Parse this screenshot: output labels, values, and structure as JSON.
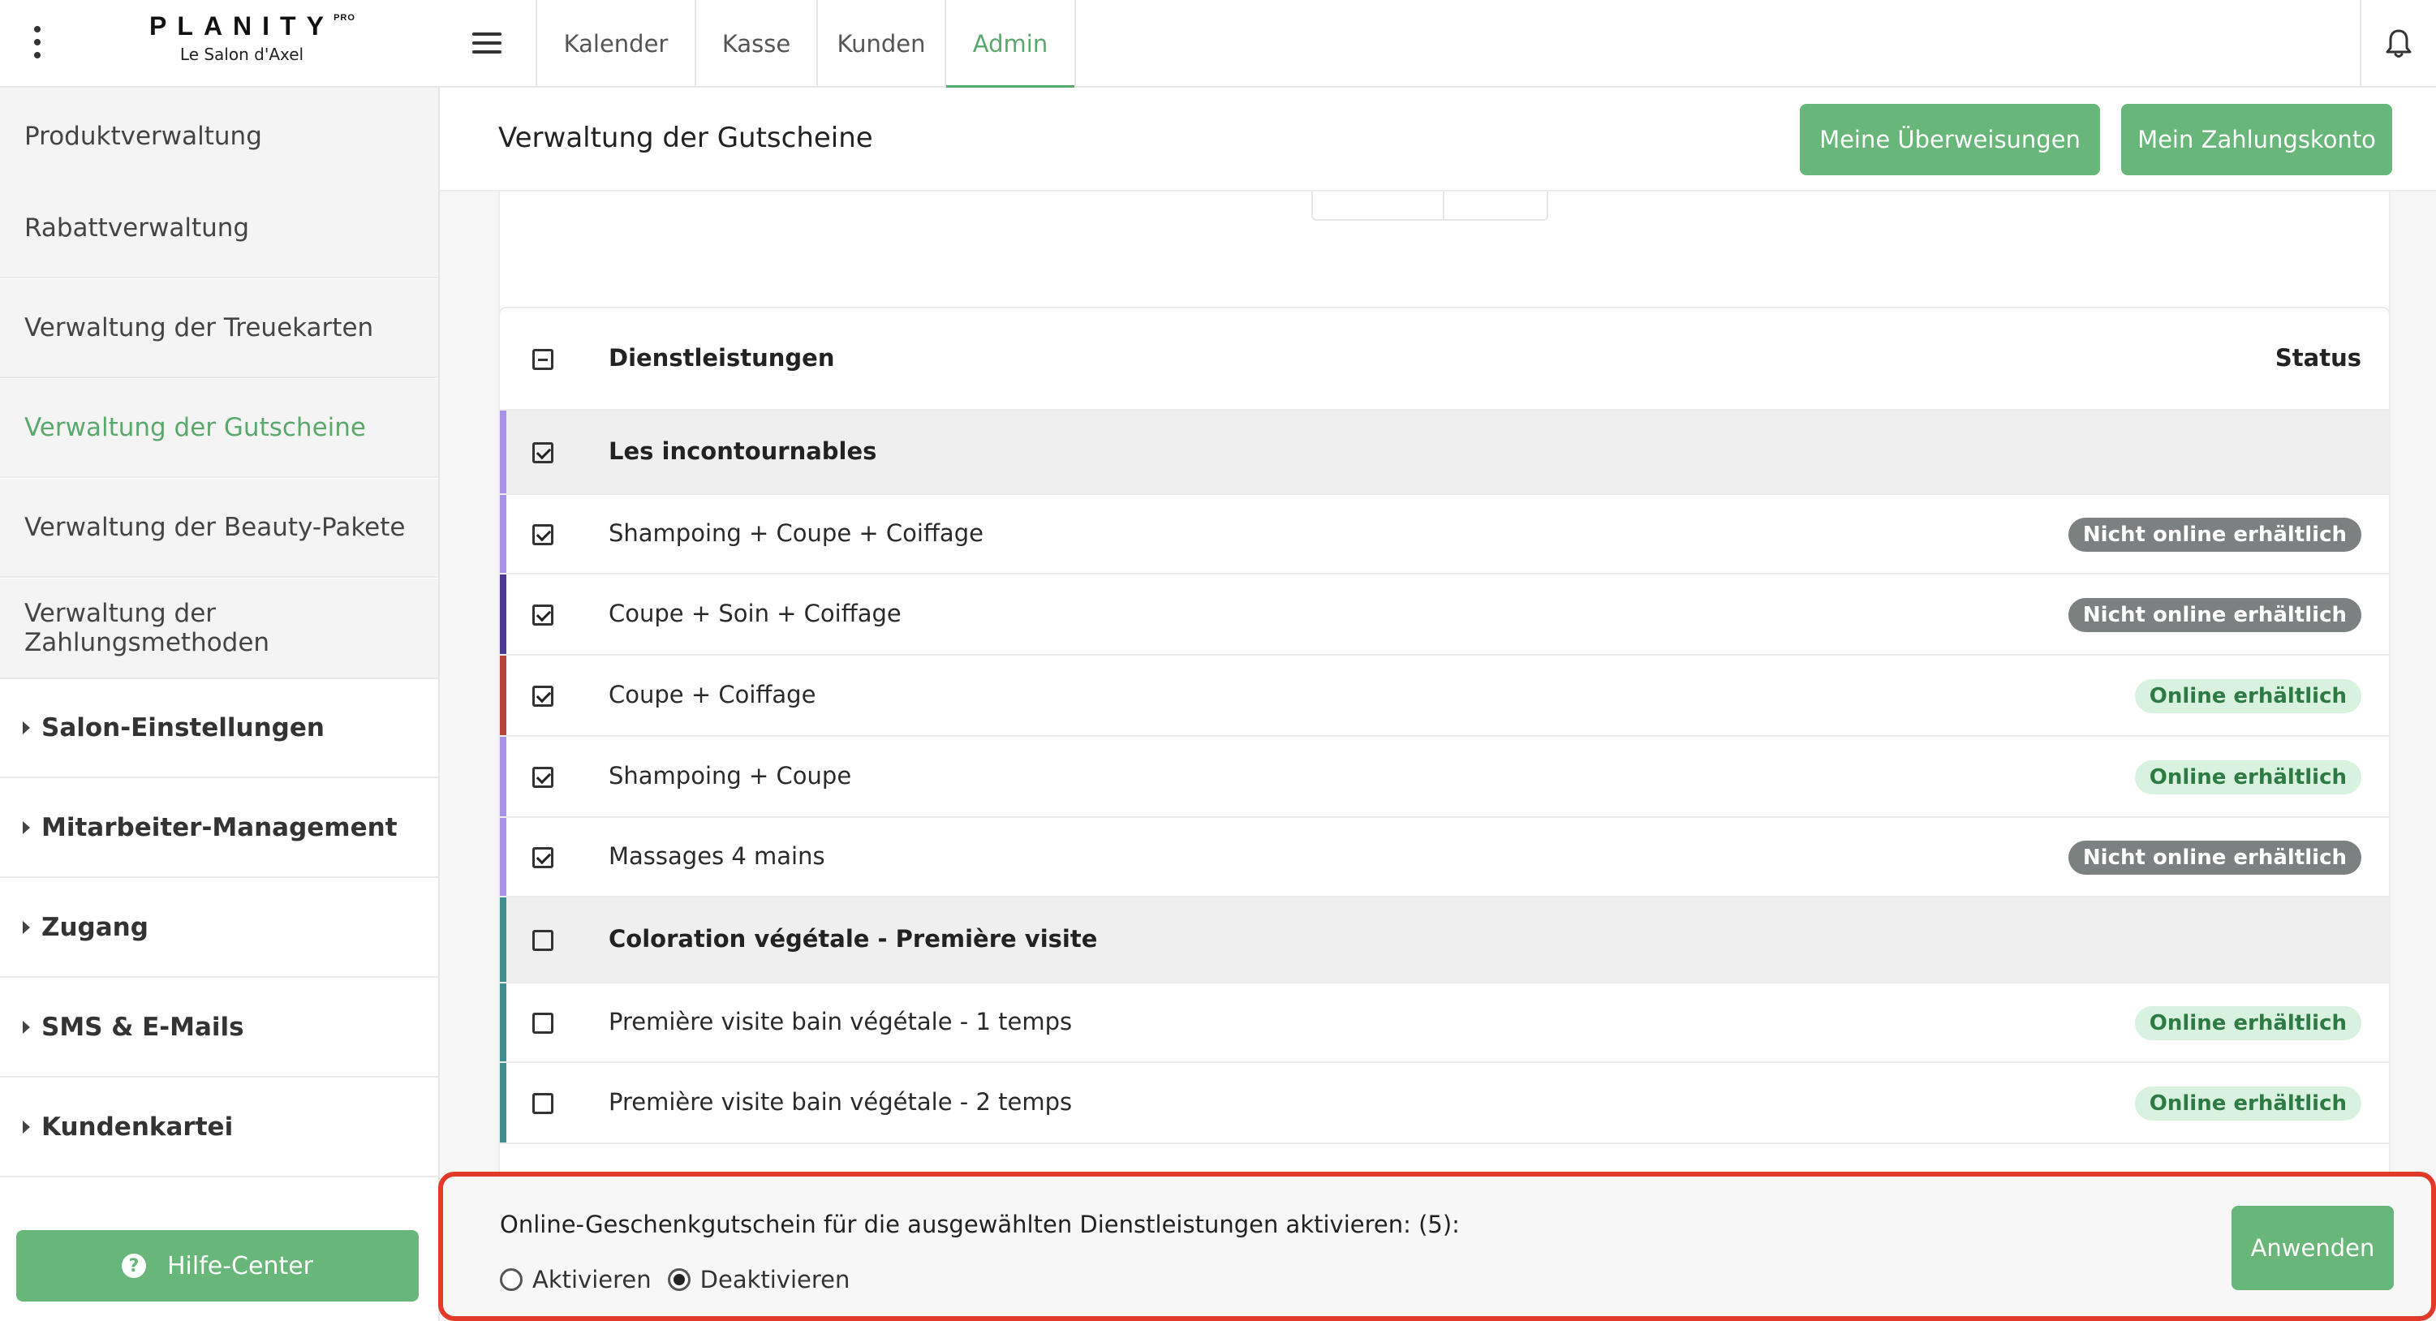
{
  "brand": {
    "name": "PLANITY",
    "superscript": "PRO",
    "salon": "Le Salon d'Axel"
  },
  "sidebar": {
    "items": [
      {
        "label": "Produktverwaltung"
      },
      {
        "label": "Rabattverwaltung"
      },
      {
        "label": "Verwaltung der Treuekarten"
      },
      {
        "label": "Verwaltung der Gutscheine",
        "active": true
      },
      {
        "label": "Verwaltung der Beauty-Pakete"
      },
      {
        "label": "Verwaltung der Zahlungsmethoden"
      }
    ],
    "sections": [
      {
        "label": "Salon-Einstellungen"
      },
      {
        "label": "Mitarbeiter-Management"
      },
      {
        "label": "Zugang"
      },
      {
        "label": "SMS & E-Mails"
      },
      {
        "label": "Kundenkartei"
      }
    ],
    "help_label": "Hilfe-Center"
  },
  "topnav": {
    "tabs": [
      {
        "label": "Kalender"
      },
      {
        "label": "Kasse"
      },
      {
        "label": "Kunden"
      },
      {
        "label": "Admin",
        "active": true
      }
    ]
  },
  "page": {
    "title": "Verwaltung der Gutscheine",
    "btn_transfers": "Meine Überweisungen",
    "btn_payment_account": "Mein Zahlungskonto"
  },
  "table": {
    "col_services": "Dienstleistungen",
    "col_status": "Status",
    "rows": [
      {
        "label": "Les incontournables",
        "group": true,
        "checked": true,
        "color": "#a992e6"
      },
      {
        "label": "Shampoing + Coupe + Coiffage",
        "checked": true,
        "color": "#a992e6",
        "status": "Nicht online erhältlich",
        "online": false
      },
      {
        "label": "Coupe + Soin + Coiffage",
        "checked": true,
        "color": "#4b3a8f",
        "status": "Nicht online erhältlich",
        "online": false
      },
      {
        "label": "Coupe + Coiffage",
        "checked": true,
        "color": "#b8433a",
        "status": "Online erhältlich",
        "online": true
      },
      {
        "label": "Shampoing + Coupe",
        "checked": true,
        "color": "#a992e6",
        "status": "Online erhältlich",
        "online": true
      },
      {
        "label": "Massages 4 mains",
        "checked": true,
        "color": "#a992e6",
        "status": "Nicht online erhältlich",
        "online": false
      },
      {
        "label": "Coloration végétale - Première visite",
        "group": true,
        "checked": false,
        "color": "#3f8f8f"
      },
      {
        "label": "Première visite bain végétale - 1 temps",
        "checked": false,
        "color": "#3f8f8f",
        "status": "Online erhältlich",
        "online": true
      },
      {
        "label": "Première visite bain végétale - 2 temps",
        "checked": false,
        "color": "#3f8f8f",
        "status": "Online erhältlich",
        "online": true
      }
    ]
  },
  "action": {
    "text": "Online-Geschenkgutschein für die ausgewählten Dienstleistungen aktivieren: (5):",
    "option_activate": "Aktivieren",
    "option_deactivate": "Deaktivieren",
    "selected": "deactivate",
    "apply_label": "Anwenden"
  },
  "colors": {
    "accent": "#68b67a",
    "active_text": "#5aa96c",
    "highlight_border": "#e23a2a"
  },
  "icons": [
    "kebab-menu-icon",
    "hamburger-menu-icon",
    "bell-icon",
    "question-circle-icon",
    "caret-right-icon"
  ]
}
